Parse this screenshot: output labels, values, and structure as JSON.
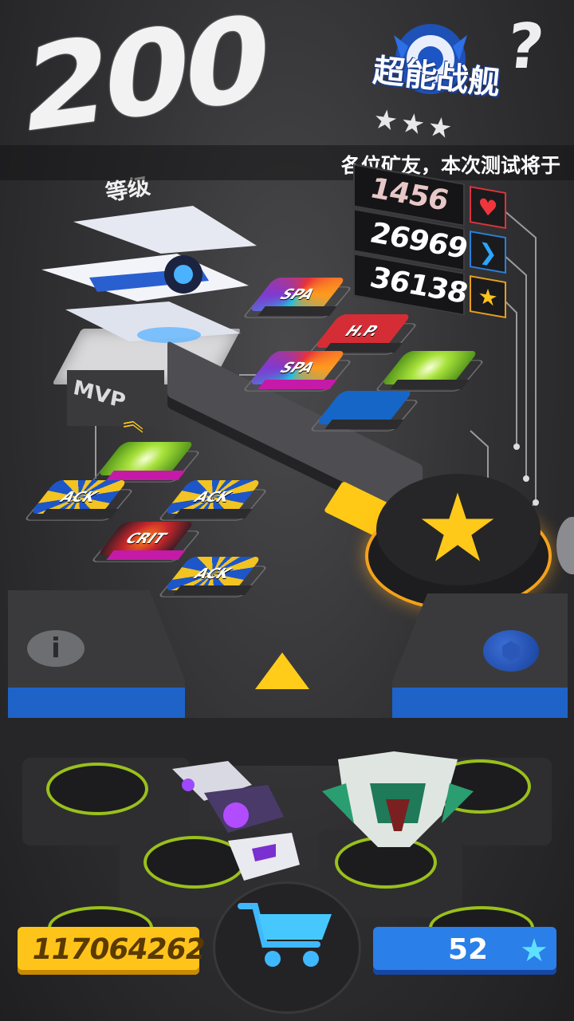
{
  "level": {
    "value": "200",
    "label": "等级"
  },
  "ship": {
    "title": "超能战舰",
    "stars": "★★★",
    "pedestal_label": "MVP"
  },
  "marquee": {
    "text": "各位矿友，本次测试将于"
  },
  "stats": [
    {
      "value": "1456",
      "icon": "heart-icon",
      "color": "#f0353d"
    },
    {
      "value": "26969",
      "icon": "speed-chevron-icon",
      "color": "#2aa6ff"
    },
    {
      "value": "36138",
      "icon": "star-icon",
      "color": "#ffc21d"
    }
  ],
  "help": {
    "glyph": "?"
  },
  "tiles": [
    {
      "text": "SPA"
    },
    {
      "text": "H.P."
    },
    {
      "text": ""
    },
    {
      "text": "SPA"
    },
    {
      "text": ""
    },
    {
      "text": ""
    },
    {
      "text": "ACK"
    },
    {
      "text": "ACK"
    },
    {
      "text": "CRIT"
    },
    {
      "text": "ACK"
    }
  ],
  "info": {
    "glyph": "i"
  },
  "currency": {
    "coins": "117064262",
    "gems": "52"
  },
  "colors": {
    "accent_yellow": "#ffc41a",
    "accent_blue": "#2b7fe8",
    "pad_green": "#9ac01b",
    "panel_blue": "#1f63c8"
  }
}
